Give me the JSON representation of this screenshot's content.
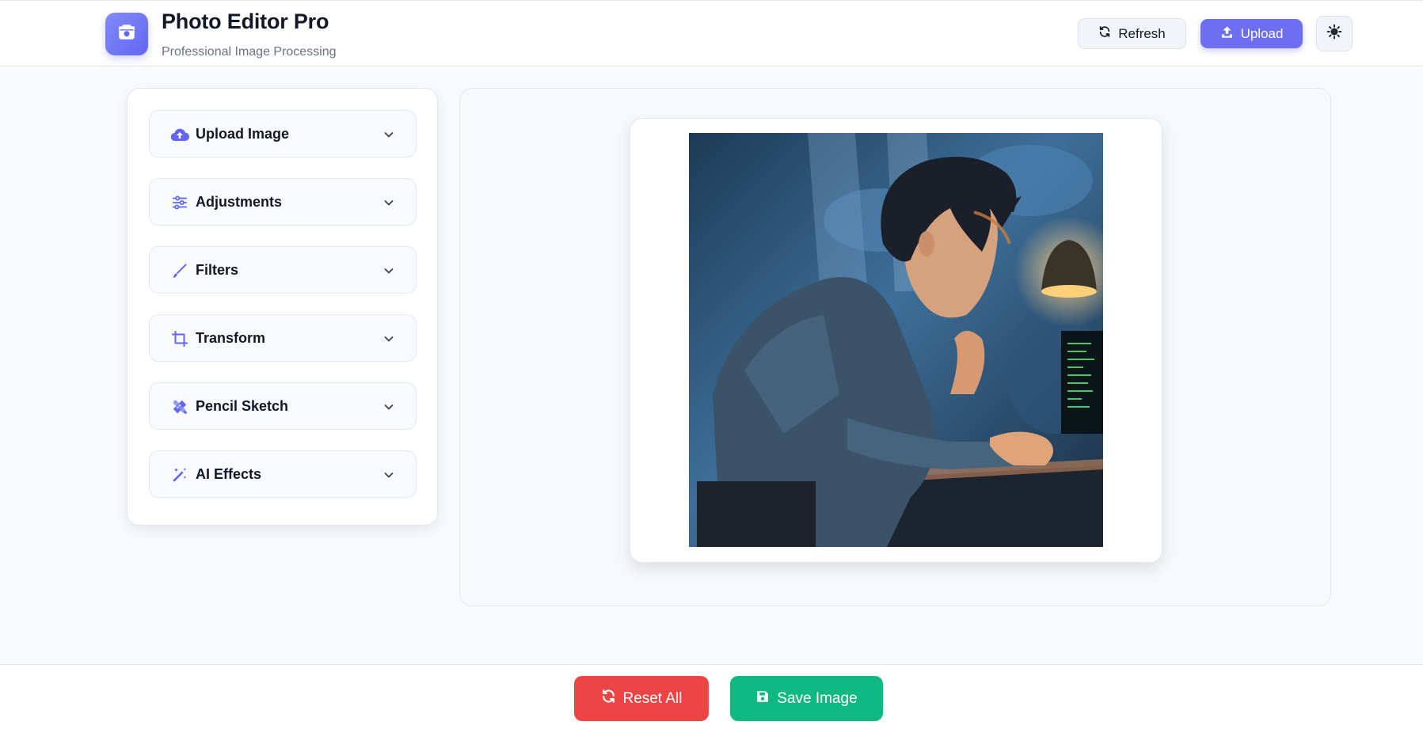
{
  "header": {
    "title": "Photo Editor Pro",
    "subtitle": "Professional Image Processing",
    "logo_icon": "camera-icon",
    "refresh_label": "Refresh",
    "upload_label": "Upload",
    "theme_icon": "sun-icon"
  },
  "sidebar": {
    "sections": [
      {
        "label": "Upload Image",
        "icon": "cloud-upload-icon"
      },
      {
        "label": "Adjustments",
        "icon": "sliders-icon"
      },
      {
        "label": "Filters",
        "icon": "brush-icon"
      },
      {
        "label": "Transform",
        "icon": "crop-icon"
      },
      {
        "label": "Pencil Sketch",
        "icon": "pencil-ruler-icon"
      },
      {
        "label": "AI Effects",
        "icon": "magic-wand-icon"
      }
    ]
  },
  "canvas": {
    "image_description_icon": "image-preview"
  },
  "footer": {
    "reset_label": "Reset All",
    "save_label": "Save Image"
  },
  "colors": {
    "accent": "#6366f1",
    "reset": "#ef4444",
    "save": "#10b981"
  }
}
